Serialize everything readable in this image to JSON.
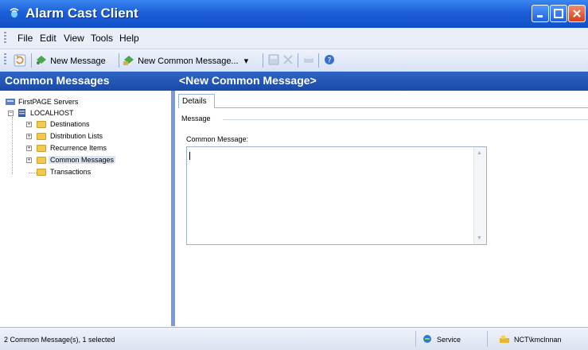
{
  "window": {
    "title": "Alarm Cast Client"
  },
  "menu": [
    "File",
    "Edit",
    "View",
    "Tools",
    "Help"
  ],
  "toolbar": {
    "new_message": "New Message",
    "new_common_message": "New Common Message..."
  },
  "left_header": "Common Messages",
  "right_header": "<New Common Message>",
  "tree": {
    "root": "FirstPAGE Servers",
    "server": "LOCALHOST",
    "items": [
      "Destinations",
      "Distribution Lists",
      "Recurrence Items",
      "Common Messages",
      "Transactions"
    ],
    "selected": "Common Messages"
  },
  "details": {
    "tab": "Details",
    "group": "Message",
    "field_label": "Common Message:",
    "value": ""
  },
  "status": {
    "left": "2 Common Message(s), 1 selected",
    "service": "Service",
    "user": "NCT\\kmclnnan"
  },
  "colors": {
    "title_bar": "#1c5fd9",
    "header_band": "#2e64c6",
    "folder": "#f4c94a"
  }
}
